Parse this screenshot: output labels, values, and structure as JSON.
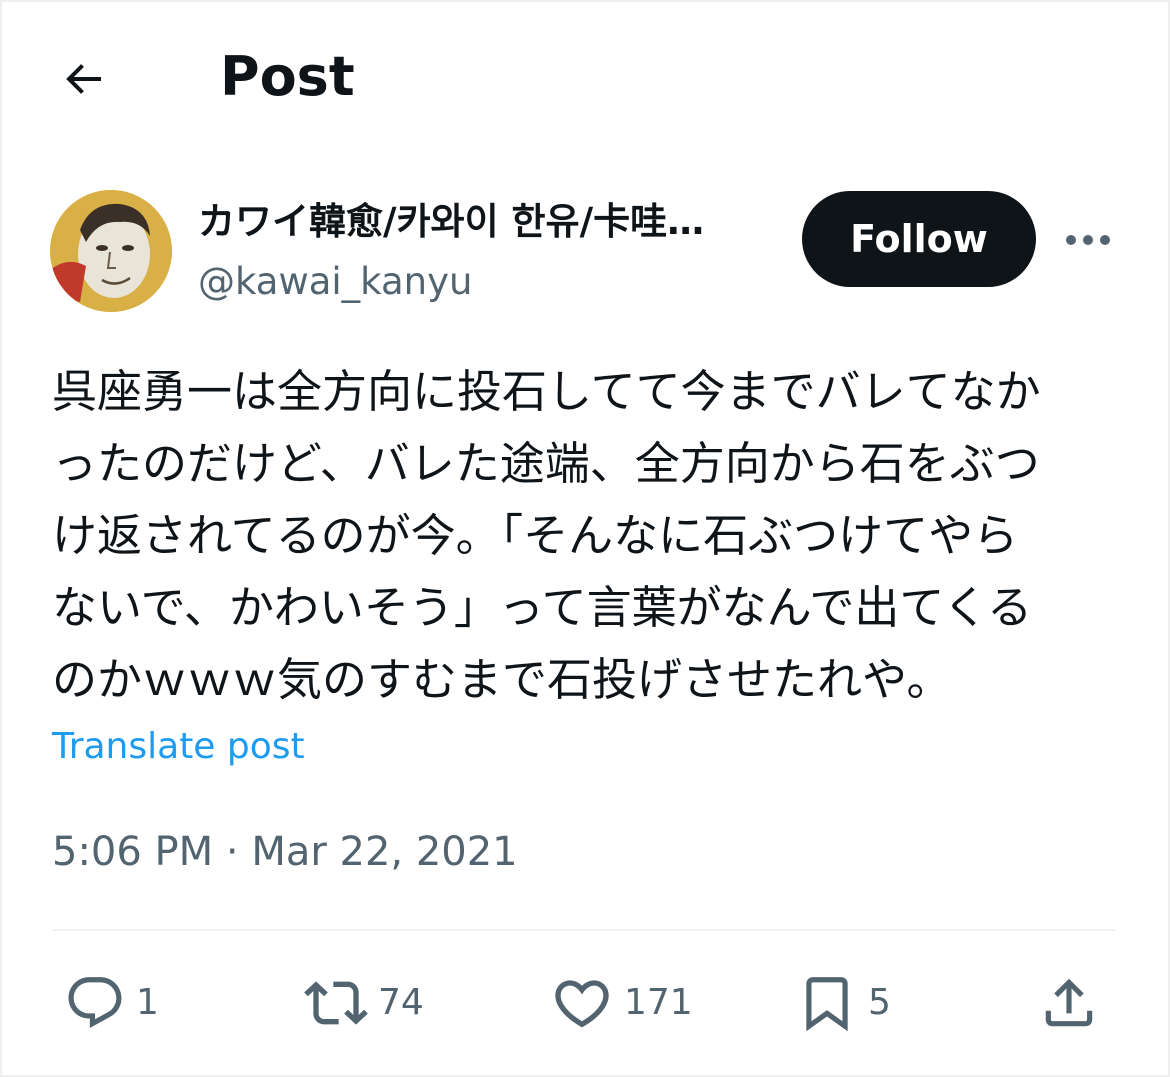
{
  "header": {
    "back_icon": "arrow-left-icon",
    "title": "Post"
  },
  "author": {
    "display_name": "カワイ韓愈/카와이 한유/卡哇…",
    "handle": "@kawai_kanyu",
    "follow_label": "Follow",
    "more_icon": "more-horizontal-icon"
  },
  "post": {
    "text": "呉座勇一は全方向に投石してて今までバレてなか\nったのだけど、バレた途端、全方向から石をぶつ\nけ返されてるのが今。「そんなに石ぶつけてやら\nないで、かわいそう」って言葉がなんで出てくる\nのかｗｗｗ気のすむまで石投げさせたれや。",
    "translate_label": "Translate post",
    "timestamp": "5:06 PM · Mar 22, 2021"
  },
  "actions": {
    "reply_count": "1",
    "repost_count": "74",
    "like_count": "171",
    "bookmark_count": "5"
  },
  "colors": {
    "text": "#0f1419",
    "secondary": "#536471",
    "link": "#1d9bf0",
    "follow_bg": "#0f1419"
  }
}
